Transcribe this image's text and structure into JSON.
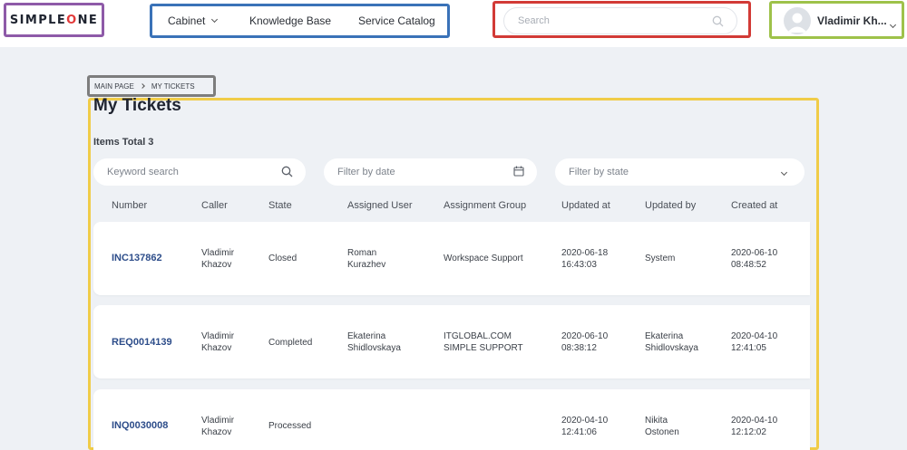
{
  "header": {
    "logo_left": "SIMPLE",
    "logo_o": "O",
    "logo_right": "NE",
    "nav": {
      "cabinet": "Cabinet",
      "knowledge_base": "Knowledge Base",
      "service_catalog": "Service Catalog"
    },
    "search": {
      "placeholder": "Search",
      "value": ""
    },
    "user": {
      "name": "Vladimir Kh..."
    }
  },
  "breadcrumb": {
    "items": [
      "MAIN PAGE",
      "MY TICKETS"
    ]
  },
  "main": {
    "title": "My Tickets",
    "items_total": "Items Total 3",
    "filters": {
      "keyword_placeholder": "Keyword search",
      "date_placeholder": "Filter by date",
      "state_placeholder": "Filter by state"
    },
    "columns": [
      "Number",
      "Caller",
      "State",
      "Assigned User",
      "Assignment Group",
      "Updated at",
      "Updated by",
      "Created at"
    ],
    "rows": [
      {
        "number": "INC137862",
        "caller": "Vladimir\nKhazov",
        "state": "Closed",
        "assigned_user": "Roman\nKurazhev",
        "assignment_group": "Workspace Support",
        "updated_at": "2020-06-18\n16:43:03",
        "updated_by": "System",
        "created_at": "2020-06-10\n08:48:52"
      },
      {
        "number": "REQ0014139",
        "caller": "Vladimir\nKhazov",
        "state": "Completed",
        "assigned_user": "Ekaterina\nShidlovskaya",
        "assignment_group": "ITGLOBAL.COM\nSIMPLE SUPPORT",
        "updated_at": "2020-06-10\n08:38:12",
        "updated_by": "Ekaterina\nShidlovskaya",
        "created_at": "2020-04-10\n12:41:05"
      },
      {
        "number": "INQ0030008",
        "caller": "Vladimir\nKhazov",
        "state": "Processed",
        "assigned_user": "",
        "assignment_group": "",
        "updated_at": "2020-04-10\n12:41:06",
        "updated_by": "Nikita\nOstonen",
        "created_at": "2020-04-10\n12:12:02"
      }
    ]
  },
  "colors": {
    "logo_box": "#8e5aa8",
    "nav_box": "#3a72b8",
    "search_box": "#d23a36",
    "user_box": "#9ec24a",
    "breadcrumb_box": "#7d7d7d",
    "main_box": "#f0cc48",
    "ticket_link": "#2d4d8a",
    "logo_accent": "#e23a3a"
  },
  "icons": [
    "search-icon",
    "calendar-icon",
    "chevron-down-icon",
    "avatar-icon",
    "chevron-right-icon"
  ]
}
